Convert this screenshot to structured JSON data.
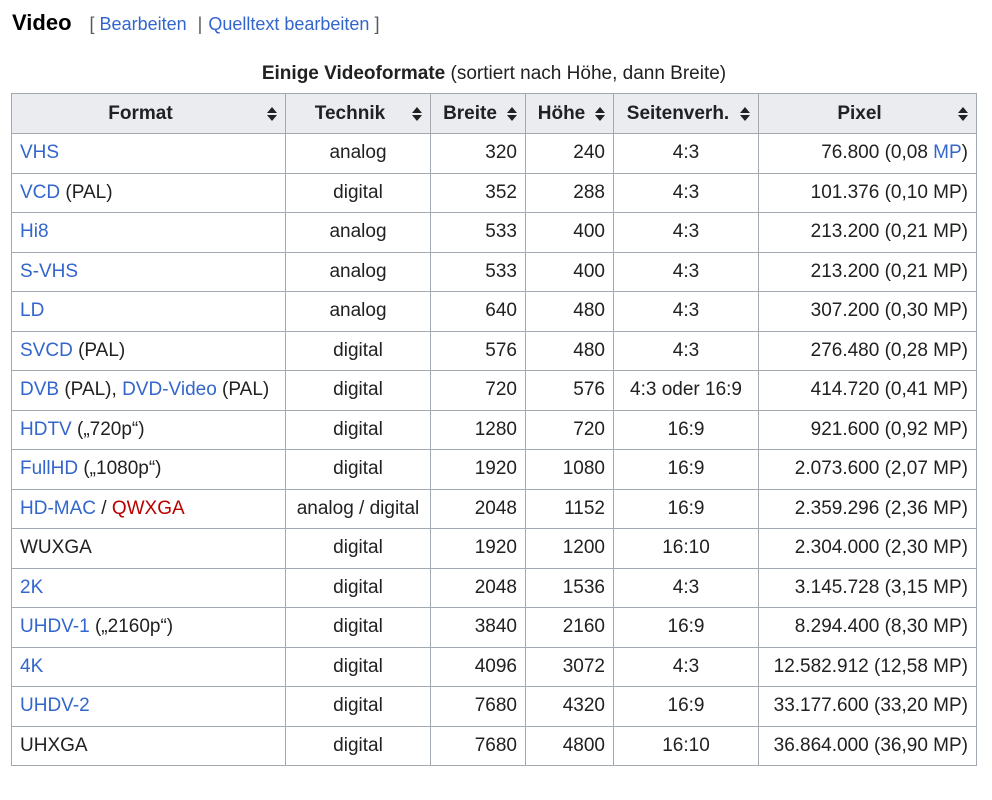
{
  "section": {
    "title": "Video",
    "edit_open": "[",
    "edit_label": "Bearbeiten",
    "edit_sep": "|",
    "edit_source_label": "Quelltext bearbeiten",
    "edit_close": "]"
  },
  "table": {
    "caption_bold": "Einige Videoformate",
    "caption_rest": " (sortiert nach Höhe, dann Breite)",
    "headers": [
      "Format",
      "Technik",
      "Breite",
      "Höhe",
      "Seitenverh.",
      "Pixel"
    ],
    "rows": [
      {
        "format": [
          {
            "text": "VHS",
            "type": "link"
          }
        ],
        "technik": "analog",
        "breite": "320",
        "hoehe": "240",
        "ratio": "4:3",
        "pixel": [
          {
            "text": "76.800 (0,08 ",
            "type": "text"
          },
          {
            "text": "MP",
            "type": "link"
          },
          {
            "text": ")",
            "type": "text"
          }
        ]
      },
      {
        "format": [
          {
            "text": "VCD",
            "type": "link"
          },
          {
            "text": " (PAL)",
            "type": "text"
          }
        ],
        "technik": "digital",
        "breite": "352",
        "hoehe": "288",
        "ratio": "4:3",
        "pixel": [
          {
            "text": "101.376 (0,10 MP)",
            "type": "text"
          }
        ]
      },
      {
        "format": [
          {
            "text": "Hi8",
            "type": "link"
          }
        ],
        "technik": "analog",
        "breite": "533",
        "hoehe": "400",
        "ratio": "4:3",
        "pixel": [
          {
            "text": "213.200 (0,21 MP)",
            "type": "text"
          }
        ]
      },
      {
        "format": [
          {
            "text": "S-VHS",
            "type": "link"
          }
        ],
        "technik": "analog",
        "breite": "533",
        "hoehe": "400",
        "ratio": "4:3",
        "pixel": [
          {
            "text": "213.200 (0,21 MP)",
            "type": "text"
          }
        ]
      },
      {
        "format": [
          {
            "text": "LD",
            "type": "link"
          }
        ],
        "technik": "analog",
        "breite": "640",
        "hoehe": "480",
        "ratio": "4:3",
        "pixel": [
          {
            "text": "307.200 (0,30 MP)",
            "type": "text"
          }
        ]
      },
      {
        "format": [
          {
            "text": "SVCD",
            "type": "link"
          },
          {
            "text": " (PAL)",
            "type": "text"
          }
        ],
        "technik": "digital",
        "breite": "576",
        "hoehe": "480",
        "ratio": "4:3",
        "pixel": [
          {
            "text": "276.480 (0,28 MP)",
            "type": "text"
          }
        ]
      },
      {
        "format": [
          {
            "text": "DVB",
            "type": "link"
          },
          {
            "text": " (PAL), ",
            "type": "text"
          },
          {
            "text": "DVD-Video",
            "type": "link"
          },
          {
            "text": " (PAL)",
            "type": "text"
          }
        ],
        "technik": "digital",
        "breite": "720",
        "hoehe": "576",
        "ratio": "4:3 oder 16:9",
        "pixel": [
          {
            "text": "414.720 (0,41 MP)",
            "type": "text"
          }
        ]
      },
      {
        "format": [
          {
            "text": "HDTV",
            "type": "link"
          },
          {
            "text": " („720p“)",
            "type": "text"
          }
        ],
        "technik": "digital",
        "breite": "1280",
        "hoehe": "720",
        "ratio": "16:9",
        "pixel": [
          {
            "text": "921.600 (0,92 MP)",
            "type": "text"
          }
        ]
      },
      {
        "format": [
          {
            "text": "FullHD",
            "type": "link"
          },
          {
            "text": " („1080p“)",
            "type": "text"
          }
        ],
        "technik": "digital",
        "breite": "1920",
        "hoehe": "1080",
        "ratio": "16:9",
        "pixel": [
          {
            "text": "2.073.600 (2,07 MP)",
            "type": "text"
          }
        ]
      },
      {
        "format": [
          {
            "text": "HD-MAC",
            "type": "link"
          },
          {
            "text": " / ",
            "type": "text"
          },
          {
            "text": "QWXGA",
            "type": "new"
          }
        ],
        "technik": "analog / digital",
        "breite": "2048",
        "hoehe": "1152",
        "ratio": "16:9",
        "pixel": [
          {
            "text": "2.359.296 (2,36 MP)",
            "type": "text"
          }
        ]
      },
      {
        "format": [
          {
            "text": "WUXGA",
            "type": "text"
          }
        ],
        "technik": "digital",
        "breite": "1920",
        "hoehe": "1200",
        "ratio": "16:10",
        "pixel": [
          {
            "text": "2.304.000 (2,30 MP)",
            "type": "text"
          }
        ]
      },
      {
        "format": [
          {
            "text": "2K",
            "type": "link"
          }
        ],
        "technik": "digital",
        "breite": "2048",
        "hoehe": "1536",
        "ratio": "4:3",
        "pixel": [
          {
            "text": "3.145.728 (3,15 MP)",
            "type": "text"
          }
        ]
      },
      {
        "format": [
          {
            "text": "UHDV-1",
            "type": "link"
          },
          {
            "text": " („2160p“)",
            "type": "text"
          }
        ],
        "technik": "digital",
        "breite": "3840",
        "hoehe": "2160",
        "ratio": "16:9",
        "pixel": [
          {
            "text": "8.294.400 (8,30 MP)",
            "type": "text"
          }
        ]
      },
      {
        "format": [
          {
            "text": "4K",
            "type": "link"
          }
        ],
        "technik": "digital",
        "breite": "4096",
        "hoehe": "3072",
        "ratio": "4:3",
        "pixel": [
          {
            "text": "12.582.912 (12,58 MP)",
            "type": "text"
          }
        ]
      },
      {
        "format": [
          {
            "text": "UHDV-2",
            "type": "link"
          }
        ],
        "technik": "digital",
        "breite": "7680",
        "hoehe": "4320",
        "ratio": "16:9",
        "pixel": [
          {
            "text": "33.177.600 (33,20 MP)",
            "type": "text"
          }
        ]
      },
      {
        "format": [
          {
            "text": "UHXGA",
            "type": "text"
          }
        ],
        "technik": "digital",
        "breite": "7680",
        "hoehe": "4800",
        "ratio": "16:10",
        "pixel": [
          {
            "text": "36.864.000 (36,90 MP)",
            "type": "text"
          }
        ]
      }
    ]
  },
  "colors": {
    "link": "#3366cc",
    "new_link": "#ba0000",
    "header_bg": "#eaecf0",
    "border": "#a2a9b1"
  },
  "icons": {
    "sort": "sort-both-icon"
  }
}
